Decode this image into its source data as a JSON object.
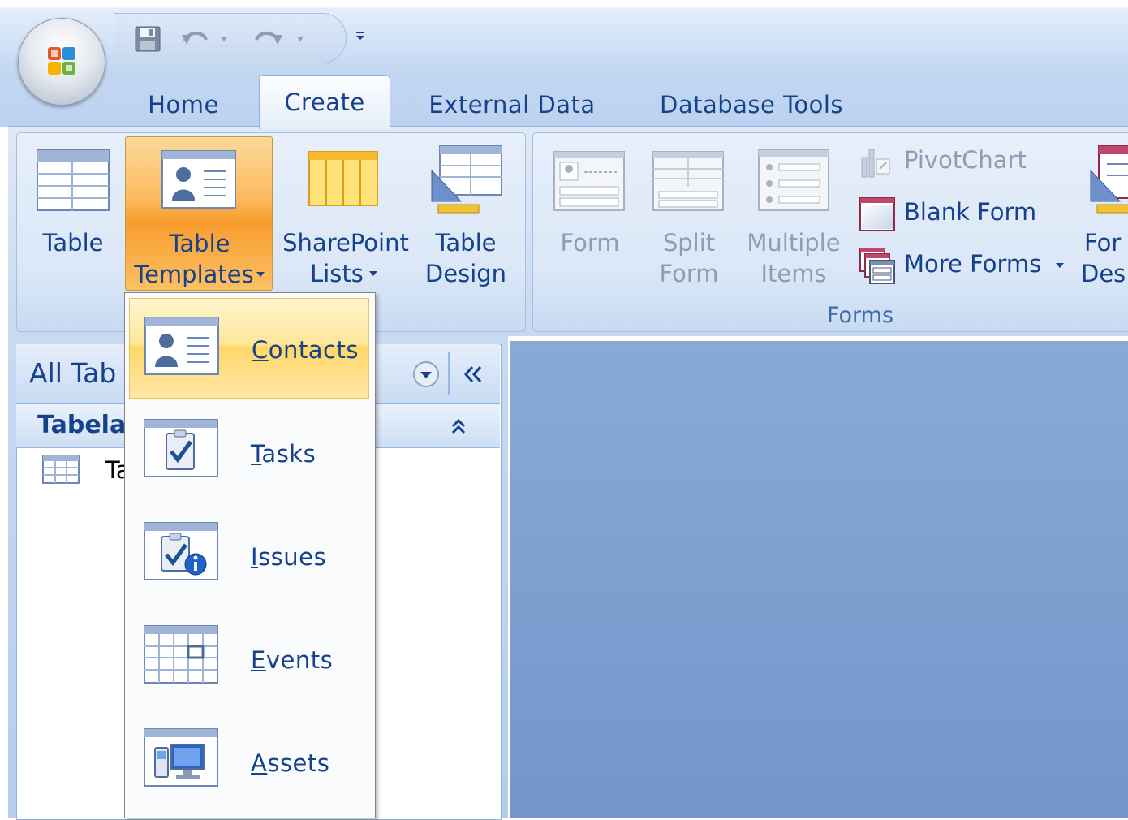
{
  "quick_access": {
    "items": [
      {
        "icon": "save-icon"
      },
      {
        "icon": "undo-icon"
      },
      {
        "icon": "redo-icon"
      },
      {
        "icon": "customize-qat-icon"
      }
    ]
  },
  "tabs": [
    {
      "label": "Home"
    },
    {
      "label": "Create"
    },
    {
      "label": "External Data"
    },
    {
      "label": "Database Tools"
    }
  ],
  "ribbon": {
    "tables": {
      "table": {
        "label": "Table"
      },
      "table_templates": {
        "line1": "Table",
        "line2": "Templates"
      },
      "sharepoint_lists": {
        "line1": "SharePoint",
        "line2": "Lists"
      },
      "table_design": {
        "line1": "Table",
        "line2": "Design"
      }
    },
    "forms": {
      "group_label": "Forms",
      "form": {
        "label": "Form"
      },
      "split_form": {
        "line1": "Split",
        "line2": "Form"
      },
      "multiple_items": {
        "line1": "Multiple",
        "line2": "Items"
      },
      "pivotchart": {
        "label": "PivotChart"
      },
      "blank_form": {
        "label": "Blank Form"
      },
      "more_forms": {
        "label": "More Forms"
      },
      "form_design": {
        "line1": "For",
        "line2": "Des"
      }
    }
  },
  "nav_pane": {
    "header": "All Tab",
    "group_header": "Tabela",
    "item_label": "Ta"
  },
  "dropdown": {
    "items": [
      {
        "label": "Contacts",
        "accel": "C",
        "rest": "ontacts",
        "icon": "contacts-template-icon"
      },
      {
        "label": "Tasks",
        "accel": "T",
        "rest": "asks",
        "icon": "tasks-template-icon"
      },
      {
        "label": "Issues",
        "accel": "I",
        "rest": "ssues",
        "icon": "issues-template-icon"
      },
      {
        "label": "Events",
        "accel": "E",
        "rest": "vents",
        "icon": "events-template-icon"
      },
      {
        "label": "Assets",
        "accel": "A",
        "rest": "ssets",
        "icon": "assets-template-icon"
      }
    ]
  },
  "colors": {
    "accent": "#15428b",
    "highlight": "#ffd768",
    "workspace": "#7f9fd0"
  }
}
